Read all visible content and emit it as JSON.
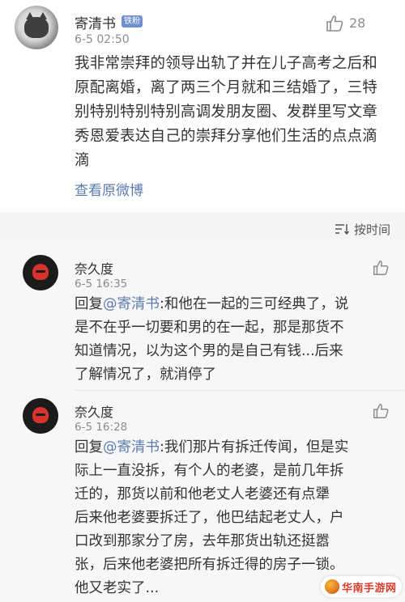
{
  "post": {
    "author": "寄清书",
    "badge": "铁粉",
    "time": "6-5 02:50",
    "like_count": "28",
    "lines": [
      "我非常崇拜的领导出轨了并在儿子高考之后和",
      "原配离婚，离了两三个月就和三结婚了，三特",
      "别特别特别特别高调发朋友圈、发群里写文章",
      "秀恩爱表达自己的崇拜分享他们生活的点点滴",
      "滴"
    ],
    "view_original": "查看原微博"
  },
  "sort": {
    "label": "按时间",
    "icon": "sort-icon"
  },
  "replies": [
    {
      "author": "奈久度",
      "time": "6-5 16:35",
      "prefix": "回复",
      "mention": "@寄清书",
      "lines": [
        ":和他在一起的三可经典了，说",
        "是不在乎一切要和男的在一起，那是那货不",
        "知道情况，以为这个男的是自己有钱...后来",
        "了解情况了，就消停了"
      ]
    },
    {
      "author": "奈久度",
      "time": "6-5 16:28",
      "prefix": "回复",
      "mention": "@寄清书",
      "lines": [
        ":我们那片有拆迁传闻，但是实",
        "际上一直没拆，有个人的老婆，是前几年拆",
        "迁的，那货以前和他老丈人老婆还有点犟",
        "后来他老婆要拆迁了，他巴结起老丈人，户",
        "口改到那家分了房，去年那货出轨还挺嚣",
        "张，后来他老婆把所有拆迁得的房子一锁。",
        "他又老实了..."
      ]
    }
  ],
  "watermark": {
    "text": "华南手游网"
  },
  "colors": {
    "link": "#5b7bb0",
    "text": "#333333",
    "muted": "#8c8c8c",
    "badge": "#6f8fd0"
  }
}
